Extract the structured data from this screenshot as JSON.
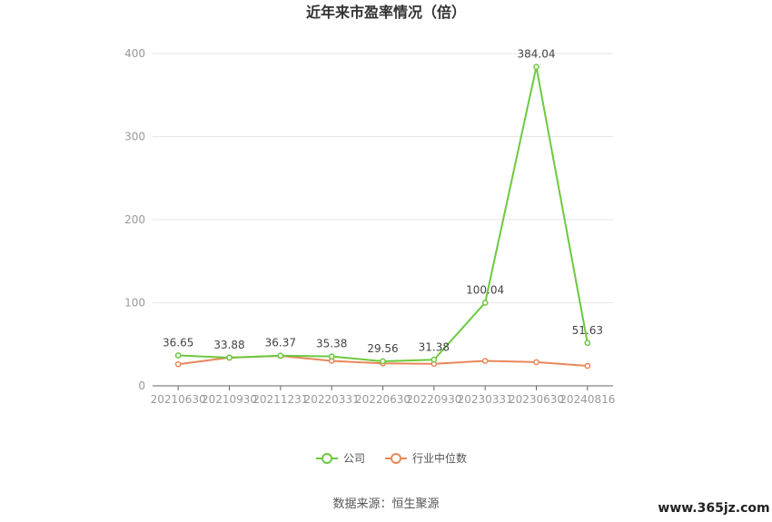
{
  "chart_data": {
    "type": "line",
    "title": "近年来市盈率情况（倍）",
    "categories": [
      "20210630",
      "20210930",
      "20211231",
      "20220331",
      "20220630",
      "20220930",
      "20230331",
      "20230630",
      "20240816"
    ],
    "series": [
      {
        "name": "公司",
        "color": "#6cc93f",
        "values": [
          36.65,
          33.88,
          36.37,
          35.38,
          29.56,
          31.38,
          100.04,
          384.04,
          51.63
        ],
        "labels": [
          "36.65",
          "33.88",
          "36.37",
          "35.38",
          "29.56",
          "31.38",
          "100.04",
          "384.04",
          "51.63"
        ]
      },
      {
        "name": "行业中位数",
        "color": "#e8875a",
        "values": [
          26,
          34,
          36,
          30,
          27,
          26.5,
          30,
          28.5,
          24
        ]
      }
    ],
    "ylim": [
      0,
      400
    ],
    "yticks": [
      0,
      100,
      200,
      300,
      400
    ],
    "ytick_labels": [
      "0",
      "100",
      "200",
      "300",
      "400"
    ],
    "grid": true,
    "legend_position": "bottom"
  },
  "footer": {
    "source": "数据来源：恒生聚源",
    "watermark": "www.365jz.com"
  }
}
